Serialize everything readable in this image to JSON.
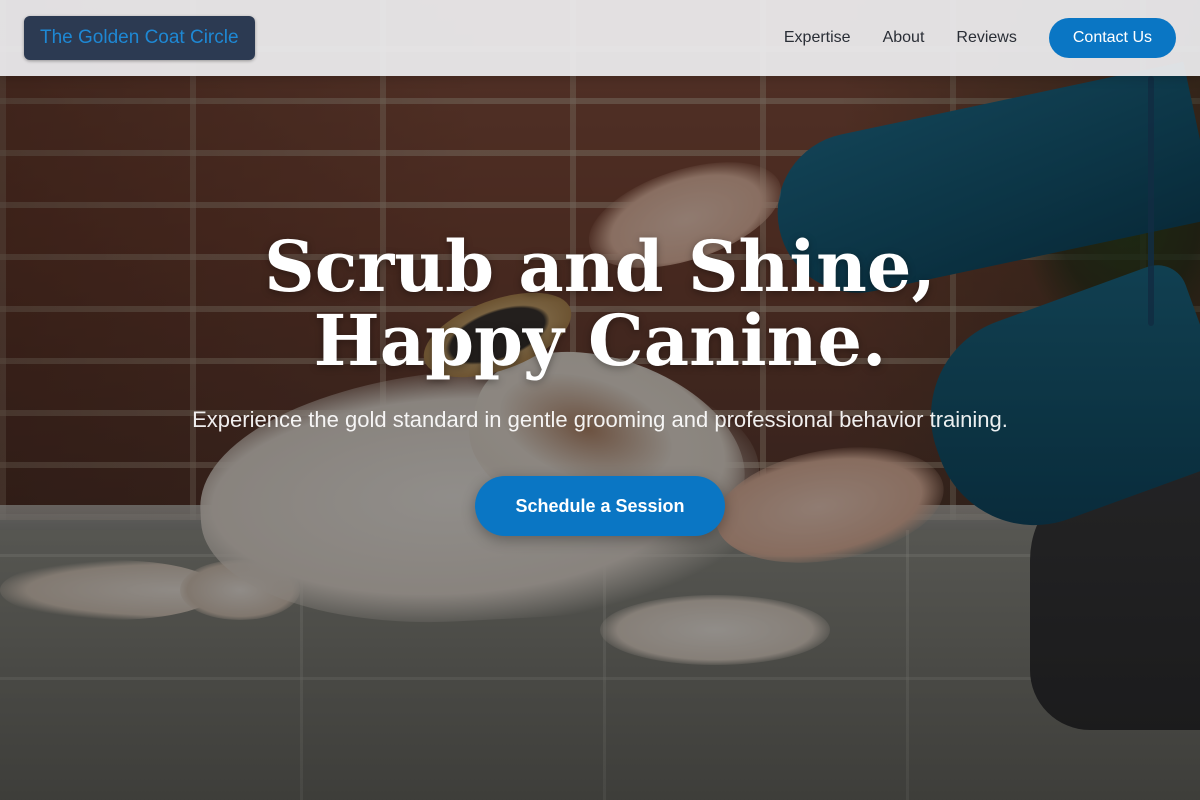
{
  "brand": {
    "name": "The Golden Coat Circle"
  },
  "nav": {
    "links": [
      {
        "label": "Expertise"
      },
      {
        "label": "About"
      },
      {
        "label": "Reviews"
      }
    ],
    "contact_label": "Contact Us"
  },
  "hero": {
    "title": "Scrub and Shine, Happy Canine.",
    "subtitle": "Experience the gold standard in gentle grooming and professional behavior training.",
    "cta_label": "Schedule a Session"
  },
  "colors": {
    "accent": "#0a76c4",
    "brand_badge_bg": "#2c3a52",
    "brand_text": "#1e88d4",
    "nav_bg": "#eeeef0"
  }
}
